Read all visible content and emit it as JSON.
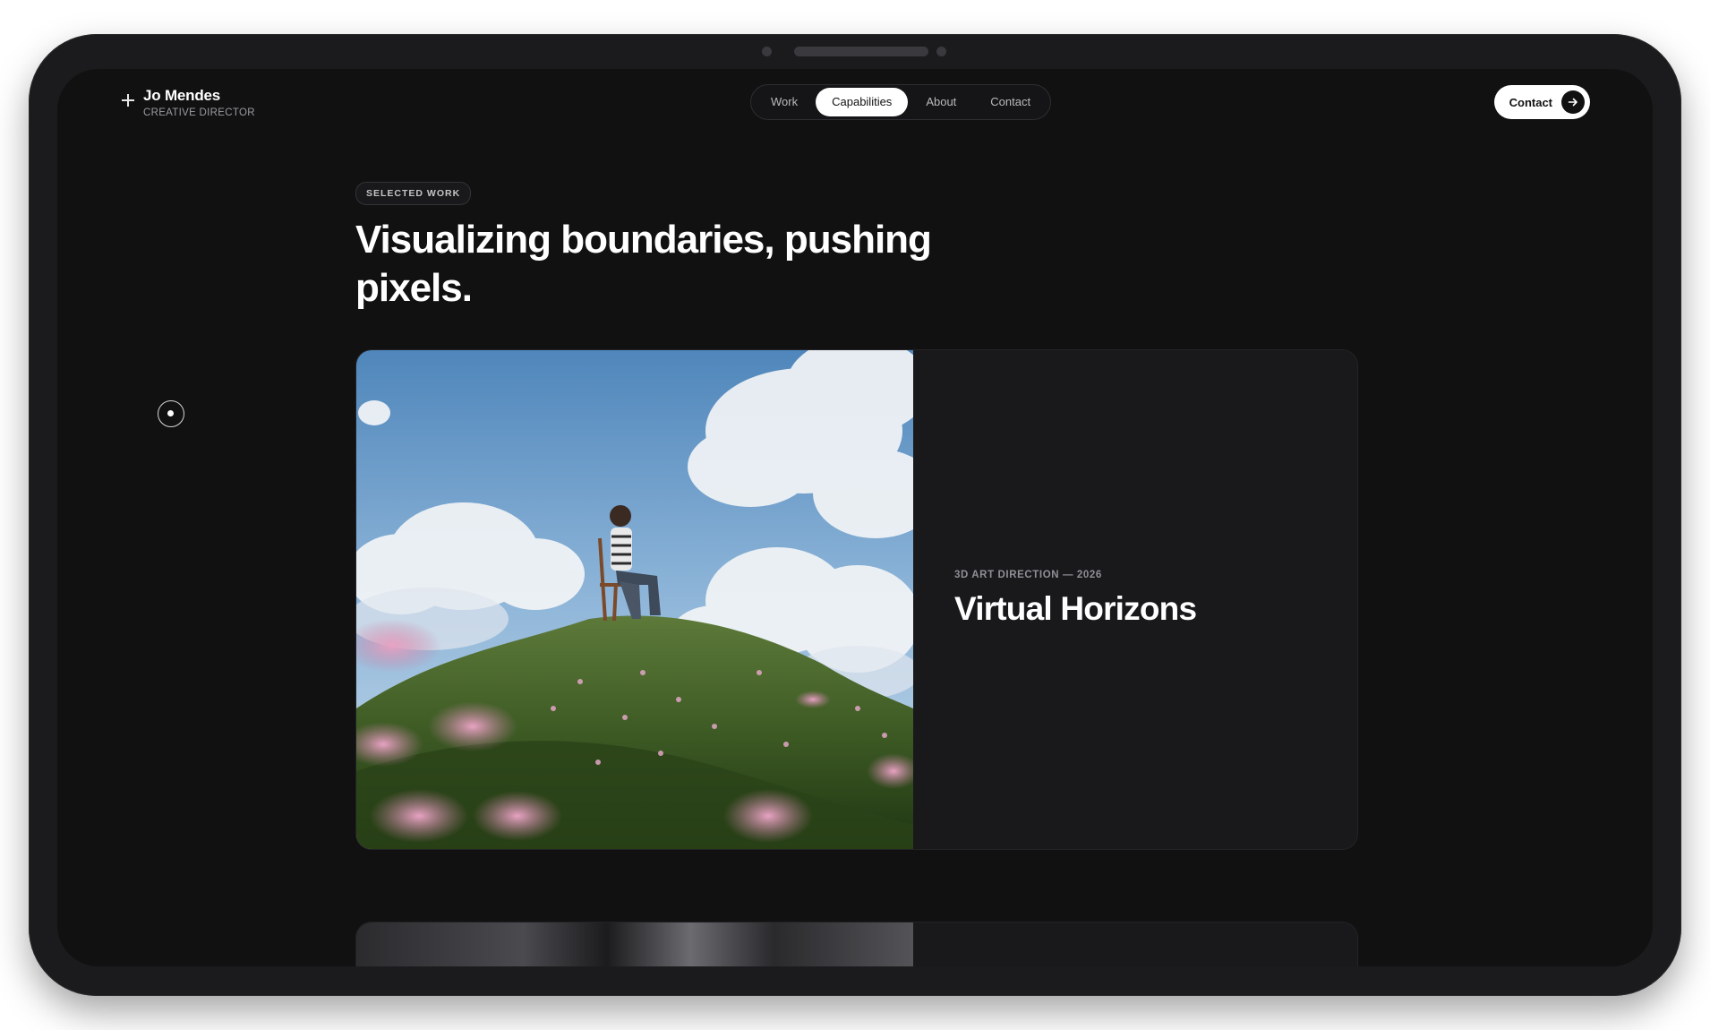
{
  "header": {
    "brand_name": "Jo Mendes",
    "brand_role": "CREATIVE DIRECTOR",
    "nav": [
      {
        "label": "Work",
        "active": false
      },
      {
        "label": "Capabilities",
        "active": true
      },
      {
        "label": "About",
        "active": false
      },
      {
        "label": "Contact",
        "active": false
      }
    ],
    "contact_button": "Contact"
  },
  "hero": {
    "badge": "SELECTED WORK",
    "headline": "Visualizing boundaries, pushing pixels."
  },
  "project": {
    "meta": "3D ART DIRECTION — 2026",
    "title": "Virtual Horizons"
  },
  "icons": {
    "brand": "plus-icon",
    "contact": "arrow-right-icon",
    "scroll": "scroll-indicator-icon"
  },
  "colors": {
    "background": "#111112",
    "card": "#19191b",
    "text": "#ffffff",
    "muted": "#9a9aa0",
    "accent": "#ffffff"
  }
}
